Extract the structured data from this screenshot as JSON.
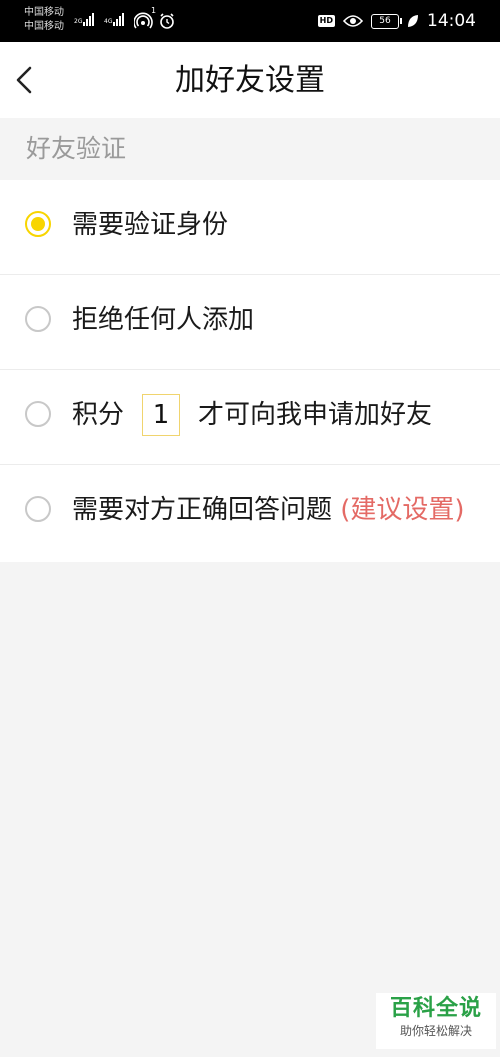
{
  "status_bar": {
    "carrier_1": "中国移动",
    "carrier_2": "中国移动",
    "sim1_net": "2G",
    "sim2_net": "4G",
    "hotspot_count": "1",
    "hd_label": "HD",
    "battery": "56",
    "time": "14:04"
  },
  "header": {
    "title": "加好友设置"
  },
  "section": {
    "title": "好友验证"
  },
  "options": [
    {
      "label": "需要验证身份",
      "checked": true
    },
    {
      "label": "拒绝任何人添加",
      "checked": false
    },
    {
      "prefix": "积分",
      "value": "1",
      "suffix": "才可向我申请加好友",
      "checked": false
    },
    {
      "label": "需要对方正确回答问题",
      "suggestion": "(建议设置)",
      "checked": false
    }
  ],
  "watermark": {
    "logo": "百科全说",
    "tagline": "助你轻松解决"
  },
  "colors": {
    "accent": "#f8d500",
    "suggestion": "#e46a65",
    "section_text": "#9a9a9a",
    "background": "#f4f4f4"
  }
}
